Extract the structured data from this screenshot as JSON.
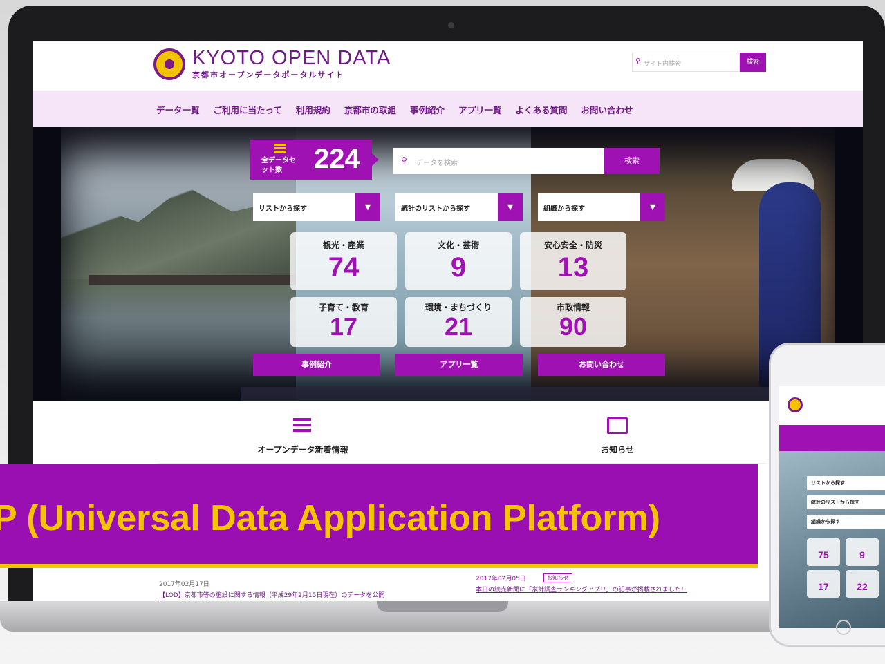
{
  "site": {
    "title": "KYOTO OPEN DATA",
    "subtitle": "京都市オープンデータポータルサイト",
    "search_placeholder": "サイト内検索",
    "search_button": "検索"
  },
  "nav": {
    "items": [
      "データ一覧",
      "ご利用に当たって",
      "利用規約",
      "京都市の取組",
      "事例紹介",
      "アプリ一覧",
      "よくある質問",
      "お問い合わせ"
    ]
  },
  "hero": {
    "dataset_label": "全データセット数",
    "dataset_count": "224",
    "search_placeholder": "データを検索",
    "search_button": "検索",
    "dropdowns": [
      "リストから探す",
      "統計のリストから探す",
      "組織から探す"
    ],
    "categories": [
      {
        "label": "観光・産業",
        "count": "74"
      },
      {
        "label": "文化・芸術",
        "count": "9"
      },
      {
        "label": "安心安全・防災",
        "count": "13"
      },
      {
        "label": "子育て・教育",
        "count": "17"
      },
      {
        "label": "環境・まちづくり",
        "count": "21"
      },
      {
        "label": "市政情報",
        "count": "90"
      }
    ],
    "buttons": [
      "事例紹介",
      "アプリ一覧",
      "お問い合わせ"
    ]
  },
  "sections": {
    "left_title": "オープンデータ新着情報",
    "right_title": "お知らせ"
  },
  "news": {
    "left_date": "2017年02月17日",
    "left_link": "【LOD】京都市等の施設に関する情報（平成29年2月15日現在）のデータを公開",
    "right_date": "2017年02月05日",
    "right_badge": "お知らせ",
    "right_link": "本日の読売新聞に「家計調査ランキングアプリ」の記事が掲載されました！"
  },
  "banner": {
    "text": "P (Universal Data Application Platform)"
  },
  "phone": {
    "dropdowns": [
      "リストから探す",
      "統計のリストから探す",
      "組織から探す"
    ],
    "counts": [
      "75",
      "9",
      "17",
      "22"
    ]
  },
  "colors": {
    "brand_purple": "#a011b3",
    "brand_yellow": "#f5c400",
    "nav_background": "#f6e4f8"
  }
}
